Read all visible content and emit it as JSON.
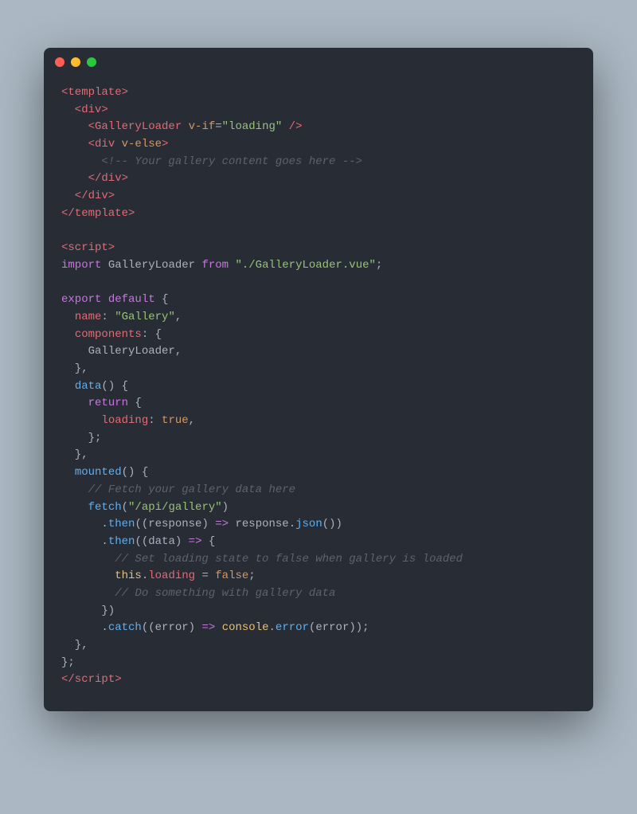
{
  "code": {
    "l1": {
      "tag_open": "<template>"
    },
    "l2": {
      "tag_open": "  <div>"
    },
    "l3": {
      "indent": "    ",
      "tag_open": "<GalleryLoader ",
      "attr": "v-if",
      "eq": "=",
      "str": "\"loading\"",
      "close": " />"
    },
    "l4": {
      "indent": "    ",
      "tag_open": "<div ",
      "attr": "v-else",
      "close": ">"
    },
    "l5": {
      "comment": "      <!-- Your gallery content goes here -->"
    },
    "l6": {
      "tag_close": "    </div>"
    },
    "l7": {
      "tag_close": "  </div>"
    },
    "l8": {
      "tag_close": "</template>"
    },
    "l9": {
      "blank": ""
    },
    "l10": {
      "tag_open": "<script>"
    },
    "l11": {
      "kw1": "import",
      "sp1": " ",
      "name": "GalleryLoader",
      "sp2": " ",
      "kw2": "from",
      "sp3": " ",
      "str": "\"./GalleryLoader.vue\"",
      "punc": ";"
    },
    "l12": {
      "blank": ""
    },
    "l13": {
      "kw1": "export",
      "sp1": " ",
      "kw2": "default",
      "sp2": " ",
      "punc": "{"
    },
    "l14": {
      "indent": "  ",
      "prop": "name",
      "punc1": ": ",
      "str": "\"Gallery\"",
      "punc2": ","
    },
    "l15": {
      "indent": "  ",
      "prop": "components",
      "punc": ": {"
    },
    "l16": {
      "indent": "    ",
      "name": "GalleryLoader",
      "punc": ","
    },
    "l17": {
      "punc": "  },"
    },
    "l18": {
      "indent": "  ",
      "fn": "data",
      "punc": "() {"
    },
    "l19": {
      "indent": "    ",
      "kw": "return",
      "punc": " {"
    },
    "l20": {
      "indent": "      ",
      "prop": "loading",
      "punc1": ": ",
      "bool": "true",
      "punc2": ","
    },
    "l21": {
      "punc": "    };"
    },
    "l22": {
      "punc": "  },"
    },
    "l23": {
      "indent": "  ",
      "fn": "mounted",
      "punc": "() {"
    },
    "l24": {
      "comment": "    // Fetch your gallery data here"
    },
    "l25": {
      "indent": "    ",
      "fn": "fetch",
      "punc1": "(",
      "str": "\"/api/gallery\"",
      "punc2": ")"
    },
    "l26": {
      "indent": "      ",
      "dot": ".",
      "fn": "then",
      "punc1": "((",
      "arg": "response",
      "punc2": ") ",
      "arrow": "=>",
      "sp": " ",
      "obj": "response",
      "dot2": ".",
      "fn2": "json",
      "punc3": "())"
    },
    "l27": {
      "indent": "      ",
      "dot": ".",
      "fn": "then",
      "punc1": "((",
      "arg": "data",
      "punc2": ") ",
      "arrow": "=>",
      "punc3": " {"
    },
    "l28": {
      "comment": "        // Set loading state to false when gallery is loaded"
    },
    "l29": {
      "indent": "        ",
      "this": "this",
      "dot": ".",
      "prop": "loading",
      "sp": " ",
      "eq": "=",
      "sp2": " ",
      "bool": "false",
      "punc": ";"
    },
    "l30": {
      "comment": "        // Do something with gallery data"
    },
    "l31": {
      "punc": "      })"
    },
    "l32": {
      "indent": "      ",
      "dot": ".",
      "fn": "catch",
      "punc1": "((",
      "arg": "error",
      "punc2": ") ",
      "arrow": "=>",
      "sp": " ",
      "obj": "console",
      "dot2": ".",
      "fn2": "error",
      "punc3": "(",
      "arg2": "error",
      "punc4": "));"
    },
    "l33": {
      "punc": "  },"
    },
    "l34": {
      "punc": "};"
    },
    "l35": {
      "tag_close": "</scrip",
      "tag_close2": "t>"
    }
  }
}
